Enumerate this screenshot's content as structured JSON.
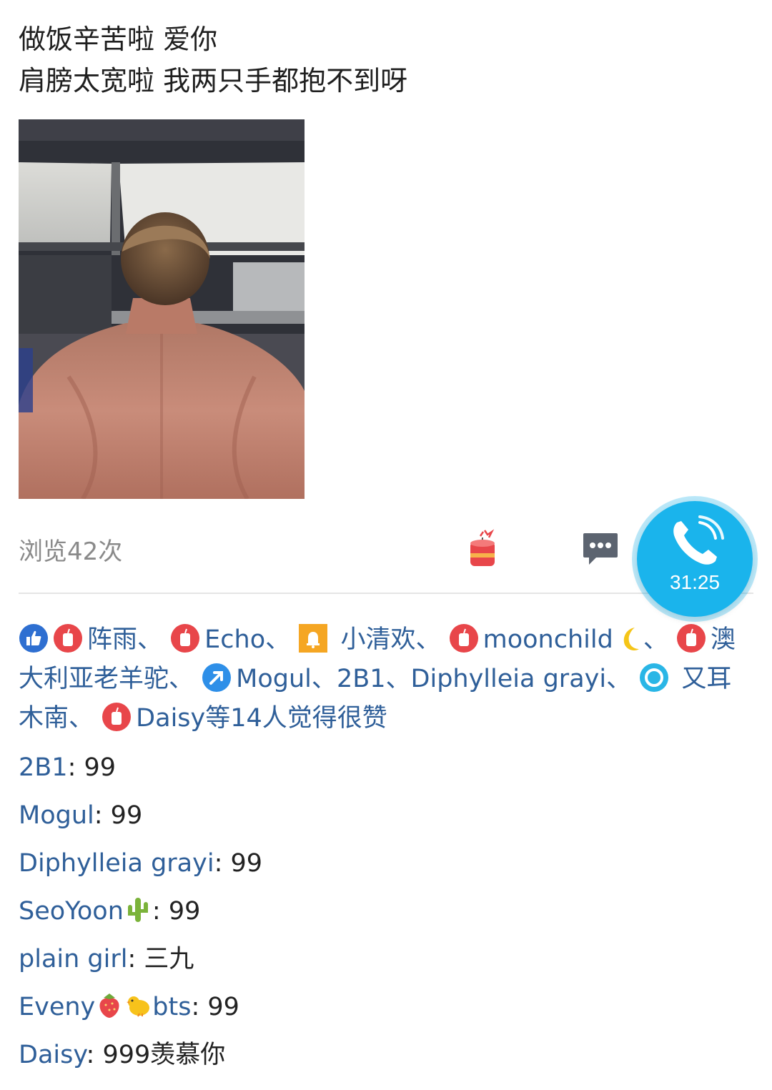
{
  "post": {
    "lines": [
      "做饭辛苦啦 爱你",
      "肩膀太宽啦 我两只手都抱不到呀"
    ]
  },
  "meta": {
    "views": "浏览42次"
  },
  "call": {
    "timer": "31:25"
  },
  "likes": {
    "names": [
      "阵雨",
      "Echo",
      "小清欢",
      "moonchild",
      "澳大利亚老羊驼",
      "Mogul",
      "2B1",
      "Diphylleia grayi",
      "又耳木南",
      "Daisy"
    ],
    "separator": "、",
    "suffix": "等14人觉得很赞"
  },
  "comments": [
    {
      "author": "2B1",
      "sep": ": ",
      "text": "99"
    },
    {
      "author": "Mogul",
      "sep": ": ",
      "text": "99"
    },
    {
      "author": "Diphylleia grayi",
      "sep": ": ",
      "text": "99"
    },
    {
      "author_prefix": "SeoYoon",
      "sep": ": ",
      "text": "99"
    },
    {
      "author": "plain girl",
      "sep": ": ",
      "text": "三九"
    },
    {
      "author_prefix": "Eveny",
      "author_suffix": "bts",
      "sep": ": ",
      "text": "99"
    },
    {
      "author": "Daisy",
      "sep": ": ",
      "text": "999羡慕你"
    }
  ],
  "colors": {
    "link": "#2f5f99",
    "accent_call": "#1ab4ec",
    "like_red": "#e8464a",
    "thumb_blue": "#2e6fd1"
  },
  "icons": {
    "like": "firecracker-like-icon",
    "comment": "speech-bubble-icon",
    "call": "phone-icon"
  }
}
